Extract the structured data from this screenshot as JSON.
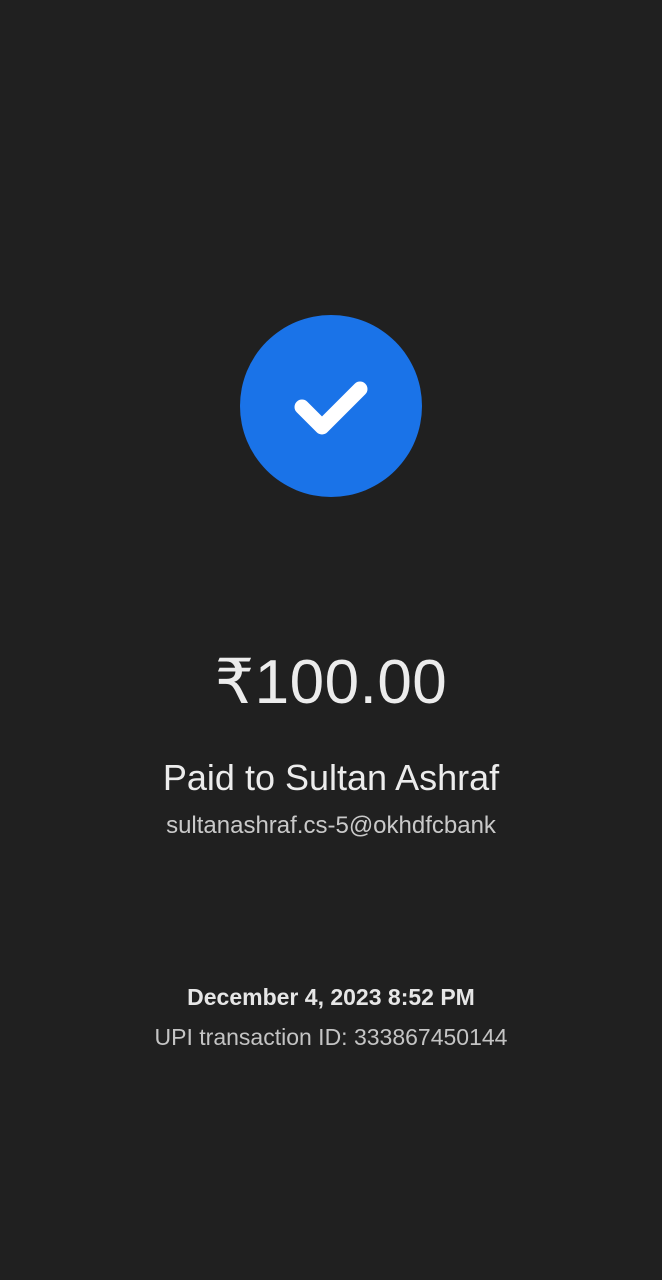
{
  "status": {
    "icon": "check-icon",
    "circle_color": "#1a73e8"
  },
  "payment": {
    "amount": "₹100.00",
    "paid_to": "Paid to Sultan Ashraf",
    "upi_id": "sultanashraf.cs-5@okhdfcbank"
  },
  "details": {
    "datetime": "December 4, 2023 8:52 PM",
    "transaction_id": "UPI transaction ID: 333867450144"
  }
}
